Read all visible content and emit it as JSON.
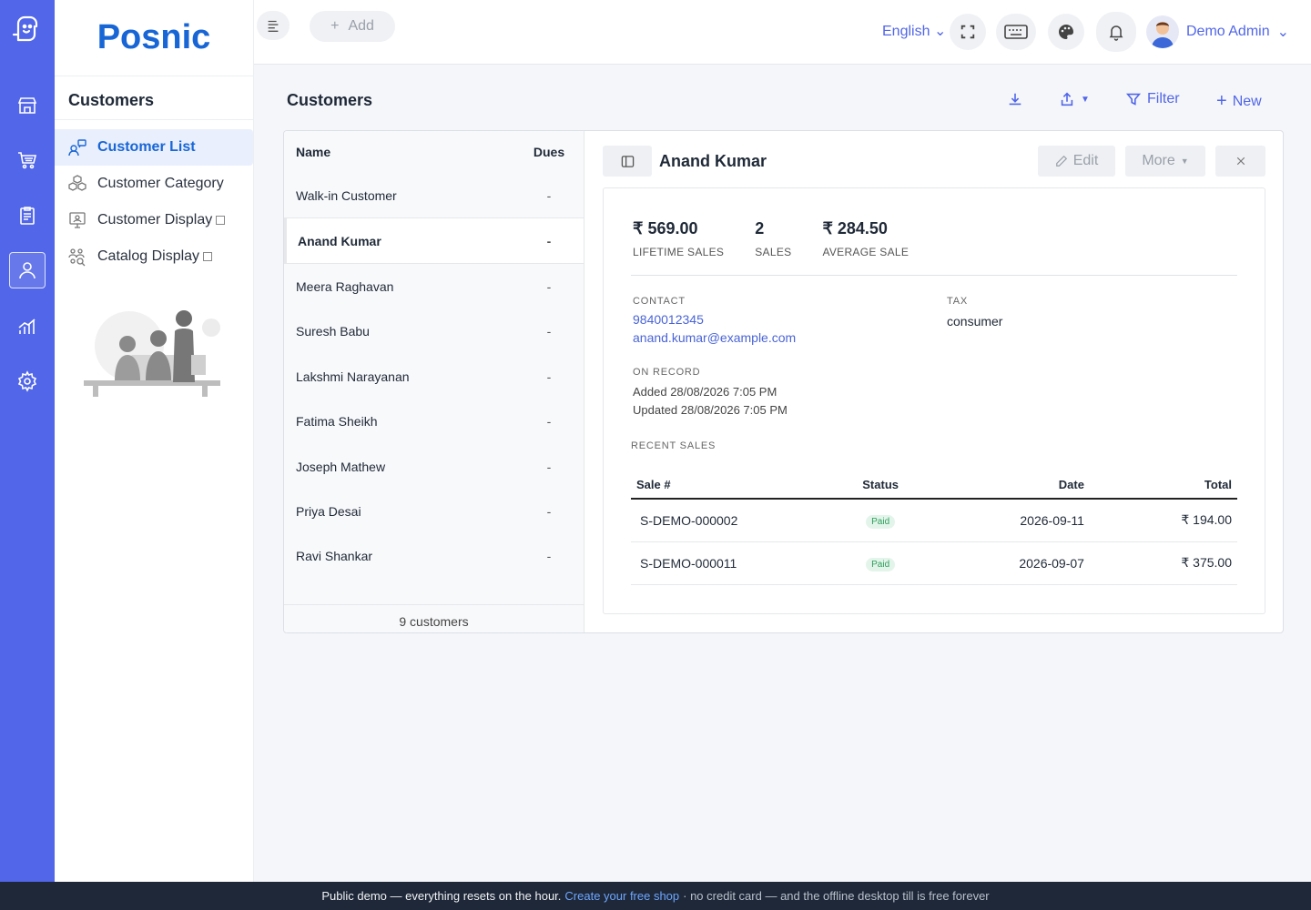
{
  "brand": "Posnic",
  "submenu": {
    "title": "Customers",
    "items": [
      {
        "label": "Customer List"
      },
      {
        "label": "Customer Category"
      },
      {
        "label": "Customer Display"
      },
      {
        "label": "Catalog Display"
      }
    ]
  },
  "topbar": {
    "add_label": "Add",
    "language": "English",
    "user_name": "Demo Admin"
  },
  "page": {
    "title": "Customers",
    "filter_label": "Filter",
    "new_label": "New"
  },
  "list": {
    "col_name": "Name",
    "col_dues": "Dues",
    "rows": [
      {
        "name": "Walk-in Customer",
        "dues": "-"
      },
      {
        "name": "Anand Kumar",
        "dues": "-"
      },
      {
        "name": "Meera Raghavan",
        "dues": "-"
      },
      {
        "name": "Suresh Babu",
        "dues": "-"
      },
      {
        "name": "Lakshmi Narayanan",
        "dues": "-"
      },
      {
        "name": "Fatima Sheikh",
        "dues": "-"
      },
      {
        "name": "Joseph Mathew",
        "dues": "-"
      },
      {
        "name": "Priya Desai",
        "dues": "-"
      },
      {
        "name": "Ravi Shankar",
        "dues": "-"
      }
    ],
    "footer": "9 customers"
  },
  "detail": {
    "name": "Anand Kumar",
    "edit_label": "Edit",
    "more_label": "More",
    "stats": [
      {
        "value": "₹ 569.00",
        "label": "LIFETIME SALES"
      },
      {
        "value": "2",
        "label": "SALES"
      },
      {
        "value": "₹ 284.50",
        "label": "AVERAGE SALE"
      }
    ],
    "contact_label": "CONTACT",
    "phone": "9840012345",
    "email": "anand.kumar@example.com",
    "tax_label": "TAX",
    "tax_value": "consumer",
    "on_record_label": "ON RECORD",
    "added": "Added 28/08/2026 7:05 PM",
    "updated": "Updated 28/08/2026 7:05 PM",
    "recent_sales_label": "RECENT SALES",
    "sales_headers": {
      "sale": "Sale #",
      "status": "Status",
      "date": "Date",
      "total": "Total"
    },
    "sales": [
      {
        "sale": "S-DEMO-000002",
        "status": "Paid",
        "date": "2026-09-11",
        "total": "₹ 194.00"
      },
      {
        "sale": "S-DEMO-000011",
        "status": "Paid",
        "date": "2026-09-07",
        "total": "₹ 375.00"
      }
    ]
  },
  "banner": {
    "text": "Public demo — everything resets on the hour.",
    "cta": "Create your free shop",
    "tail": "· no credit card — and the offline desktop till is free forever"
  },
  "colors": {
    "rail": "#5166e8",
    "brand": "#1866d6",
    "link": "#4a64d6",
    "banner": "#1e2838"
  }
}
